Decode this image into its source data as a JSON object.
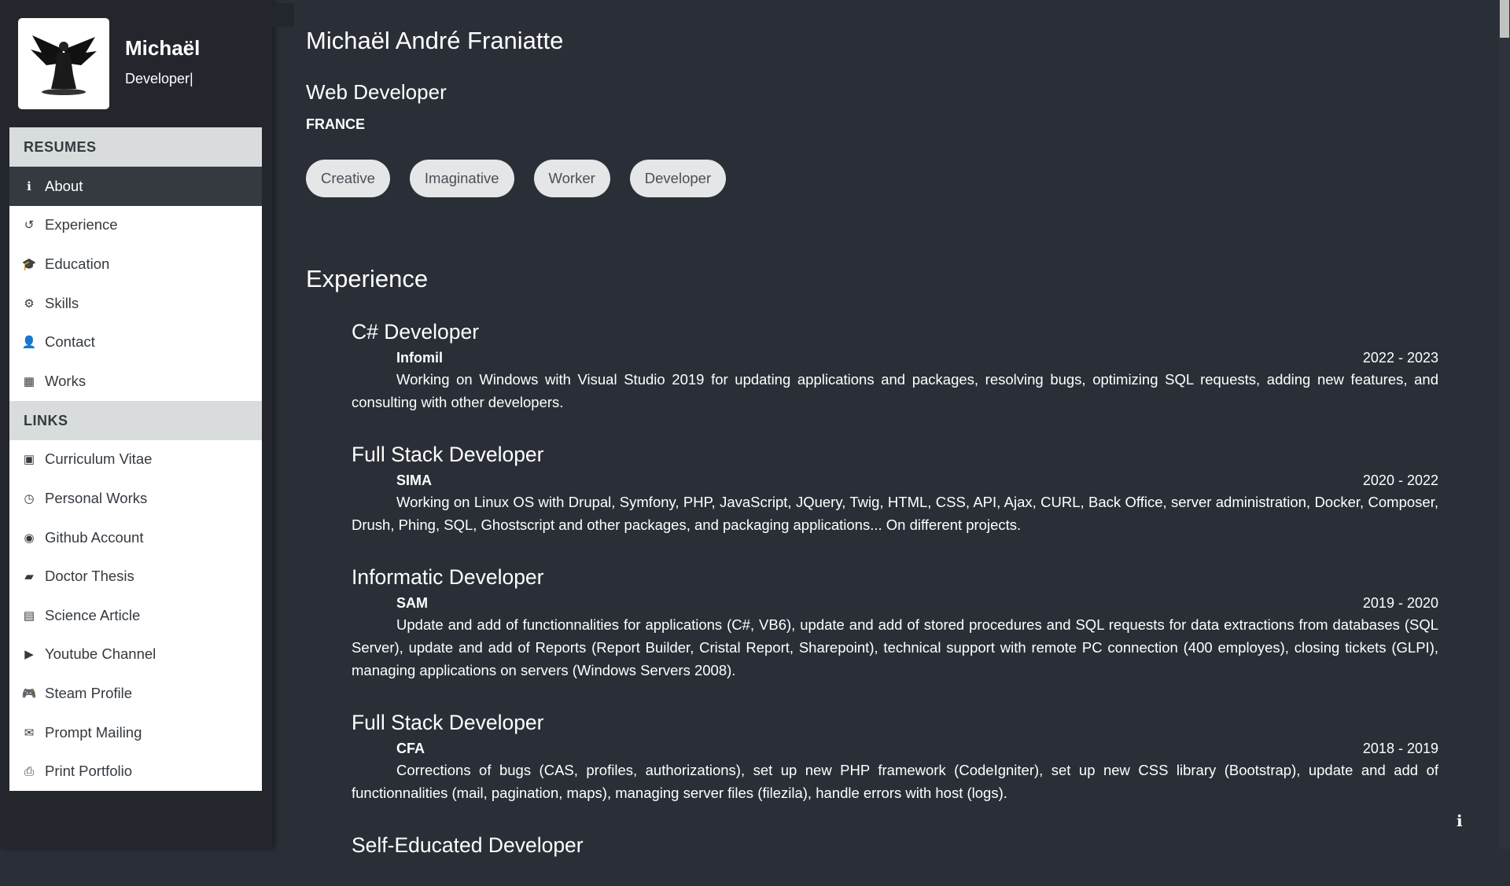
{
  "profile": {
    "name": "Michaël",
    "role": "Developer|"
  },
  "menu": {
    "resumes_label": "RESUMES",
    "resumes": [
      {
        "label": "About",
        "icon": "info-icon",
        "glyph": "ℹ"
      },
      {
        "label": "Experience",
        "icon": "history-icon",
        "glyph": "↺"
      },
      {
        "label": "Education",
        "icon": "graduation-cap-icon",
        "glyph": "🎓"
      },
      {
        "label": "Skills",
        "icon": "cogs-icon",
        "glyph": "⚙"
      },
      {
        "label": "Contact",
        "icon": "user-icon",
        "glyph": "👤"
      },
      {
        "label": "Works",
        "icon": "cubes-icon",
        "glyph": "▦"
      }
    ],
    "links_label": "LINKS",
    "links": [
      {
        "label": "Curriculum Vitae",
        "icon": "camera-icon",
        "glyph": "▣"
      },
      {
        "label": "Personal Works",
        "icon": "clock-icon",
        "glyph": "◷"
      },
      {
        "label": "Github Account",
        "icon": "github-icon",
        "glyph": "◉"
      },
      {
        "label": "Doctor Thesis",
        "icon": "book-icon",
        "glyph": "▰"
      },
      {
        "label": "Science Article",
        "icon": "newspaper-icon",
        "glyph": "▤"
      },
      {
        "label": "Youtube Channel",
        "icon": "youtube-icon",
        "glyph": "▶"
      },
      {
        "label": "Steam Profile",
        "icon": "gamepad-icon",
        "glyph": "🎮"
      },
      {
        "label": "Prompt Mailing",
        "icon": "envelope-icon",
        "glyph": "✉"
      },
      {
        "label": "Print Portfolio",
        "icon": "print-icon",
        "glyph": "⎙"
      }
    ]
  },
  "main": {
    "title": "Michaël André Franiatte",
    "subtitle": "Web Developer",
    "country": "FRANCE",
    "tags": [
      "Creative",
      "Imaginative",
      "Worker",
      "Developer"
    ],
    "experience_heading": "Experience",
    "jobs": [
      {
        "title": "C# Developer",
        "company": "Infomil",
        "dates": "2022 - 2023",
        "desc": "Working on Windows with Visual Studio 2019 for updating applications and packages, resolving bugs, optimizing SQL requests, adding new features, and consulting with other developers."
      },
      {
        "title": "Full Stack Developer",
        "company": "SIMA",
        "dates": "2020 - 2022",
        "desc": "Working on Linux OS with Drupal, Symfony, PHP, JavaScript, JQuery, Twig, HTML, CSS, API, Ajax, CURL, Back Office, server administration, Docker, Composer, Drush, Phing, SQL, Ghostscript and other packages, and packaging applications... On different projects."
      },
      {
        "title": "Informatic Developer",
        "company": "SAM",
        "dates": "2019 - 2020",
        "desc": "Update and add of functionnalities for applications (C#, VB6), update and add of stored procedures and SQL requests for data extractions from databases (SQL Server), update and add of Reports (Report Builder, Cristal Report, Sharepoint), technical support with remote PC connection (400 employes), closing tickets (GLPI), managing applications on servers (Windows Servers 2008)."
      },
      {
        "title": "Full Stack Developer",
        "company": "CFA",
        "dates": "2018 - 2019",
        "desc": "Corrections of bugs (CAS, profiles, authorizations), set up new PHP framework (CodeIgniter), set up new CSS library (Bootstrap), update and add of functionnalities (mail, pagination, maps), managing server files (filezila), handle errors with host (logs)."
      },
      {
        "title": "Self-Educated Developer",
        "company": "",
        "dates": "",
        "desc": ""
      }
    ]
  },
  "info_button": "i"
}
